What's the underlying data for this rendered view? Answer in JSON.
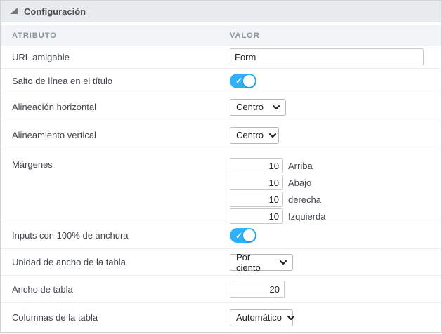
{
  "panel": {
    "title": "Configuración"
  },
  "table_header": {
    "attribute": "ATRIBUTO",
    "value": "VALOR"
  },
  "icons": {
    "toggle_check": "✓"
  },
  "colors": {
    "toggle_on": "#2fb1f8",
    "titlebar_bg": "#e7ebee",
    "table_header_bg": "#f2f5f7",
    "accent_text": "#40464c"
  },
  "rows": {
    "url_amigable": {
      "label": "URL amigable",
      "value": "Form"
    },
    "salto_linea": {
      "label": "Salto de línea en el título",
      "state": "on"
    },
    "alineacion_h": {
      "label": "Alineación horizontal",
      "value": "Centro"
    },
    "alineamiento_v": {
      "label": "Alineamiento vertical",
      "value": "Centro"
    },
    "margenes": {
      "label": "Márgenes",
      "inputs": [
        {
          "value": "10",
          "label": "Arriba"
        },
        {
          "value": "10",
          "label": "Abajo"
        },
        {
          "value": "10",
          "label": "derecha"
        },
        {
          "value": "10",
          "label": "Izquierda"
        }
      ]
    },
    "inputs_100": {
      "label": "Inputs con 100% de anchura",
      "state": "on"
    },
    "unidad_ancho": {
      "label": "Unidad de ancho de la tabla",
      "value": "Por ciento"
    },
    "ancho_tabla": {
      "label": "Ancho de tabla",
      "value": "20"
    },
    "columnas_tabla": {
      "label": "Columnas de la tabla",
      "value": "Automático"
    }
  }
}
